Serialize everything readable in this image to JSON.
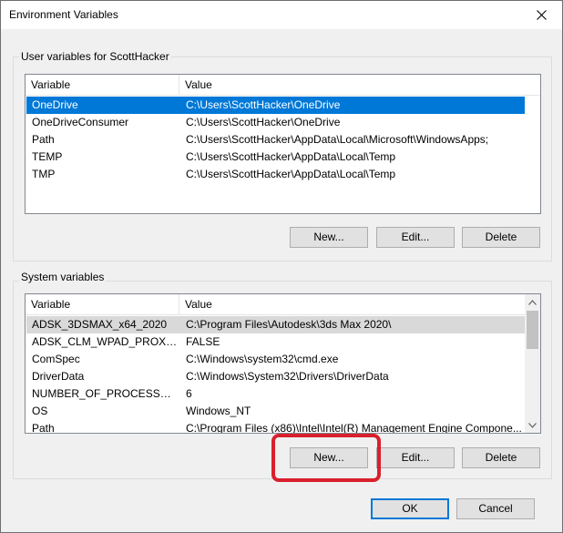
{
  "window": {
    "title": "Environment Variables"
  },
  "user_section": {
    "label": "User variables for ScottHacker",
    "columns": [
      "Variable",
      "Value"
    ],
    "rows": [
      {
        "variable": "OneDrive",
        "value": "C:\\Users\\ScottHacker\\OneDrive"
      },
      {
        "variable": "OneDriveConsumer",
        "value": "C:\\Users\\ScottHacker\\OneDrive"
      },
      {
        "variable": "Path",
        "value": "C:\\Users\\ScottHacker\\AppData\\Local\\Microsoft\\WindowsApps;"
      },
      {
        "variable": "TEMP",
        "value": "C:\\Users\\ScottHacker\\AppData\\Local\\Temp"
      },
      {
        "variable": "TMP",
        "value": "C:\\Users\\ScottHacker\\AppData\\Local\\Temp"
      }
    ],
    "buttons": {
      "new": "New...",
      "edit": "Edit...",
      "delete": "Delete"
    }
  },
  "system_section": {
    "label": "System variables",
    "columns": [
      "Variable",
      "Value"
    ],
    "rows": [
      {
        "variable": "ADSK_3DSMAX_x64_2020",
        "value": "C:\\Program Files\\Autodesk\\3ds Max 2020\\"
      },
      {
        "variable": "ADSK_CLM_WPAD_PROXY_...",
        "value": "FALSE"
      },
      {
        "variable": "ComSpec",
        "value": "C:\\Windows\\system32\\cmd.exe"
      },
      {
        "variable": "DriverData",
        "value": "C:\\Windows\\System32\\Drivers\\DriverData"
      },
      {
        "variable": "NUMBER_OF_PROCESSORS",
        "value": "6"
      },
      {
        "variable": "OS",
        "value": "Windows_NT"
      },
      {
        "variable": "Path",
        "value": "C:\\Program Files (x86)\\Intel\\Intel(R) Management Engine Compone..."
      }
    ],
    "buttons": {
      "new": "New...",
      "edit": "Edit...",
      "delete": "Delete"
    }
  },
  "footer": {
    "ok": "OK",
    "cancel": "Cancel"
  },
  "colors": {
    "selection": "#0078d7",
    "highlight": "#d9202d"
  }
}
